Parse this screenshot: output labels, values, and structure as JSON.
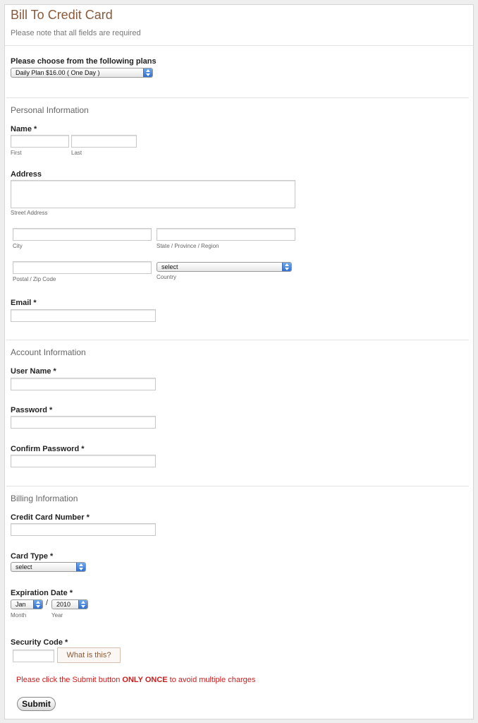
{
  "header": {
    "title": "Bill To Credit Card",
    "subtitle": "Please note that all fields are required"
  },
  "plan": {
    "label": "Please choose from the following plans",
    "selected": "Daily Plan $16.00 ( One Day )"
  },
  "personal": {
    "section_title": "Personal Information",
    "name_label": "Name *",
    "first_label": "First",
    "last_label": "Last",
    "address_label": "Address",
    "street_label": "Street Address",
    "city_label": "City",
    "state_label": "State / Province / Region",
    "postal_label": "Postal / Zip Code",
    "country_label": "Country",
    "country_selected": "select",
    "email_label": "Email *"
  },
  "account": {
    "section_title": "Account Information",
    "username_label": "User Name *",
    "password_label": "Password *",
    "confirm_label": "Confirm Password *"
  },
  "billing": {
    "section_title": "Billing Information",
    "cc_label": "Credit Card Number *",
    "card_type_label": "Card Type *",
    "card_type_selected": "select",
    "expiry_label": "Expiration Date *",
    "month_selected": "Jan",
    "separator": "/",
    "year_selected": "2010",
    "month_label": "Month",
    "year_label": "Year",
    "security_label": "Security Code *",
    "help_button": "What is this?"
  },
  "notice": {
    "before": "Please click the Submit button ",
    "emphasis": "ONLY ONCE",
    "after": " to avoid multiple charges"
  },
  "submit_label": "Submit",
  "colors": {
    "title": "#8a5a3a",
    "notice": "#d11b1b",
    "select_arrow": "#2f6fd0"
  }
}
